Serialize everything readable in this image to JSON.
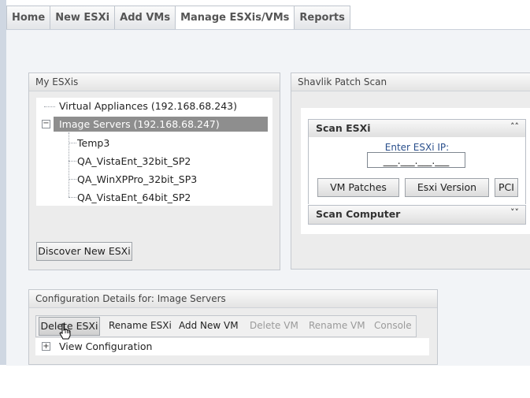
{
  "tabs": [
    "Home",
    "New ESXi",
    "Add VMs",
    "Manage ESXis/VMs",
    "Reports"
  ],
  "my_esxis": {
    "title": "My ESXis",
    "tree": {
      "root1": "Virtual Appliances (192.168.68.243)",
      "root2": "Image Servers (192.168.68.247)",
      "children": [
        "Temp3",
        "QA_VistaEnt_32bit_SP2",
        "QA_WinXPPro_32bit_SP3",
        "QA_VistaEnt_64bit_SP2"
      ]
    },
    "discover_button": "Discover New ESXi"
  },
  "patch_scan": {
    "title": "Shavlik Patch Scan",
    "scan_esxi": {
      "header": "Scan ESXi",
      "ip_label": "Enter ESXi IP:",
      "ip_placeholder": "___.___.___.___",
      "buttons": [
        "VM Patches",
        "Esxi Version",
        "PCI"
      ]
    },
    "scan_computer": {
      "header": "Scan Computer"
    }
  },
  "config": {
    "title": "Configuration Details for: Image Servers",
    "toolbar": {
      "delete_esxi": "Delete ESXi",
      "rename_esxi": "Rename ESXi",
      "add_new_vm": "Add New VM",
      "delete_vm": "Delete VM",
      "rename_vm": "Rename VM",
      "console": "Console"
    },
    "view_configuration": "View Configuration"
  },
  "icons": [
    "collapse-icon",
    "expand-icon",
    "chevron-up-icon",
    "chevron-down-icon",
    "hand-cursor-icon"
  ],
  "colors": {
    "selected_node_bg": "#8e8e8e",
    "disabled_text": "#9a9a9a",
    "ip_label": "#2a4f8c"
  }
}
